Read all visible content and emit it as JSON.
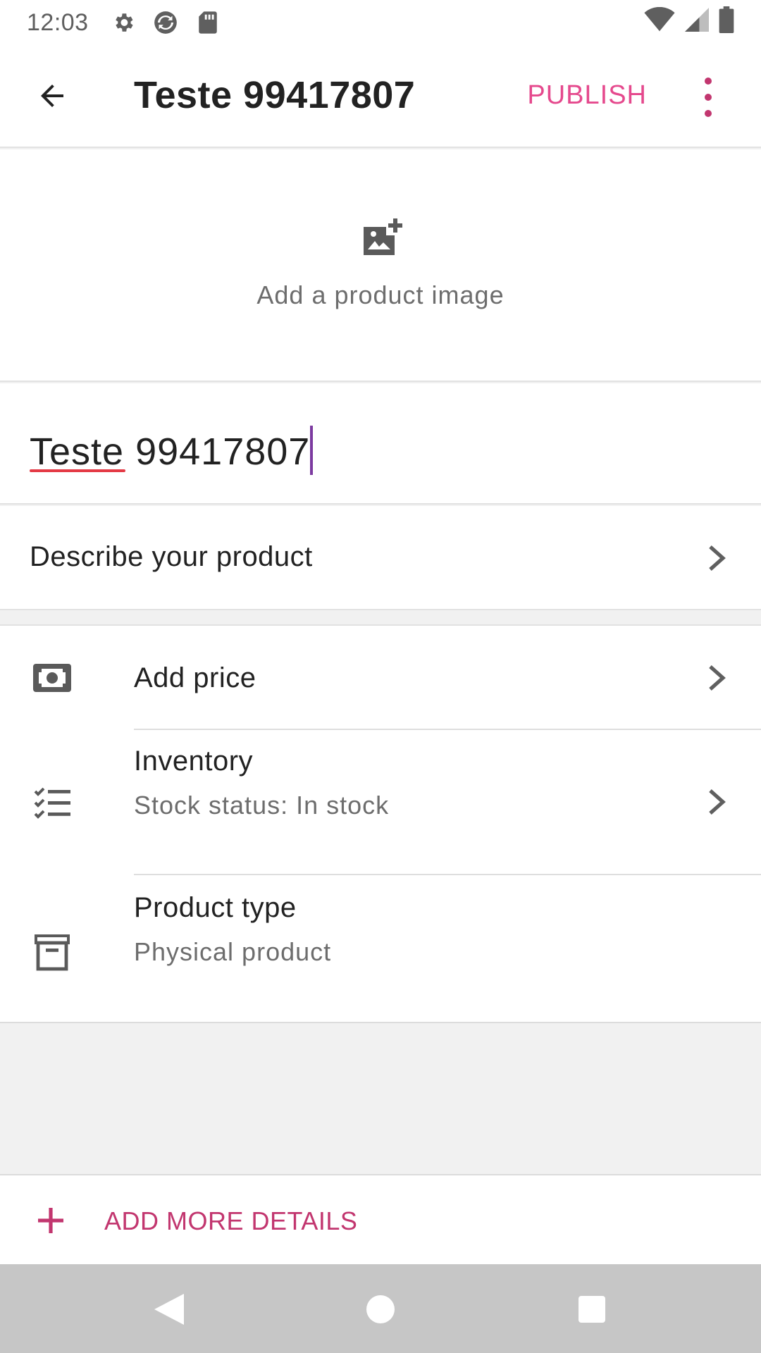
{
  "status_bar": {
    "time": "12:03",
    "icons": [
      "gear-icon",
      "sync-icon",
      "sd-card-icon",
      "wifi-icon",
      "signal-icon",
      "battery-icon"
    ]
  },
  "app_bar": {
    "title": "Teste 99417807",
    "publish_label": "PUBLISH",
    "back_icon": "arrow-back-icon",
    "overflow_icon": "more-vert-icon"
  },
  "image_section": {
    "label": "Add a product image",
    "icon": "add-photo-icon"
  },
  "name_field": {
    "value": "Teste 99417807"
  },
  "description": {
    "label": "Describe your product"
  },
  "settings": [
    {
      "key": "price",
      "icon": "money-icon",
      "title": "Add price",
      "subtitle": ""
    },
    {
      "key": "inventory",
      "icon": "checklist-icon",
      "title": "Inventory",
      "subtitle": "Stock status: In stock"
    },
    {
      "key": "product_type",
      "icon": "archive-box-icon",
      "title": "Product type",
      "subtitle": "Physical product"
    }
  ],
  "footer": {
    "add_details_label": "ADD MORE DETAILS",
    "icon": "plus-icon"
  },
  "colors": {
    "accent": "#e5498d",
    "accent_dark": "#c2366f",
    "cursor": "#7c3aa0",
    "spellcheck": "#e43a45"
  }
}
